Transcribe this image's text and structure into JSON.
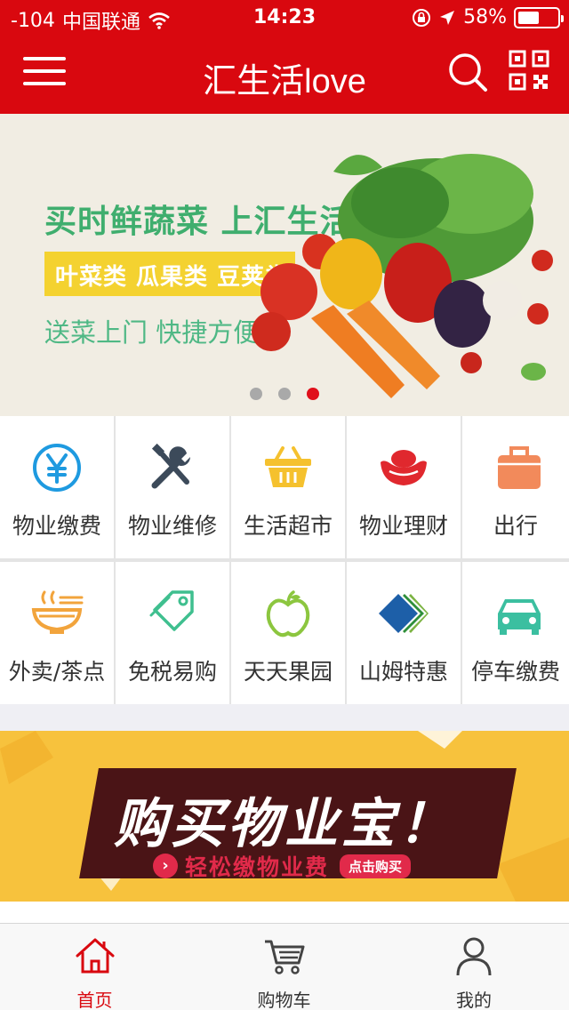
{
  "status_bar": {
    "signal": "-104",
    "carrier": "中国联通",
    "time": "14:23",
    "battery": "58%",
    "battery_level": 0.58
  },
  "header": {
    "title": "汇生活love",
    "icons": [
      "menu-icon",
      "search-icon",
      "qr-code-icon"
    ]
  },
  "banner": {
    "headline": "买时鲜蔬菜 上汇生活",
    "tags": "叶菜类 瓜果类 豆荚类",
    "subline": "送菜上门 快捷方便",
    "page_count": 3,
    "active_index": 2
  },
  "services": [
    {
      "label": "物业缴费",
      "icon": "yuan-icon",
      "color": "#1e9ae0"
    },
    {
      "label": "物业维修",
      "icon": "tools-icon",
      "color": "#3c4a5a"
    },
    {
      "label": "生活超市",
      "icon": "basket-icon",
      "color": "#f5c12e"
    },
    {
      "label": "物业理财",
      "icon": "gold-ingot-icon",
      "color": "#e0282e"
    },
    {
      "label": "出行",
      "icon": "suitcase-icon",
      "color": "#f28a5b"
    },
    {
      "label": "外卖/茶点",
      "icon": "noodle-bowl-icon",
      "color": "#f2a43c"
    },
    {
      "label": "免税易购",
      "icon": "tags-icon",
      "color": "#3fbf8f"
    },
    {
      "label": "天天果园",
      "icon": "apple-icon",
      "color": "#8cc63f"
    },
    {
      "label": "山姆特惠",
      "icon": "sams-club-icon",
      "color": "#1d5fa8"
    },
    {
      "label": "停车缴费",
      "icon": "car-icon",
      "color": "#3bbfa0"
    }
  ],
  "promo": {
    "title": "购买物业宝！",
    "subtitle": "轻松缴物业费",
    "button": "点击购买"
  },
  "tabbar": {
    "tabs": [
      {
        "label": "首页",
        "icon": "home-icon",
        "active": true
      },
      {
        "label": "购物车",
        "icon": "cart-icon",
        "active": false
      },
      {
        "label": "我的",
        "icon": "user-icon",
        "active": false
      }
    ]
  },
  "colors": {
    "primary": "#d9080f",
    "banner_bg": "#f1ede3",
    "promo_bg": "#f7c23d"
  }
}
